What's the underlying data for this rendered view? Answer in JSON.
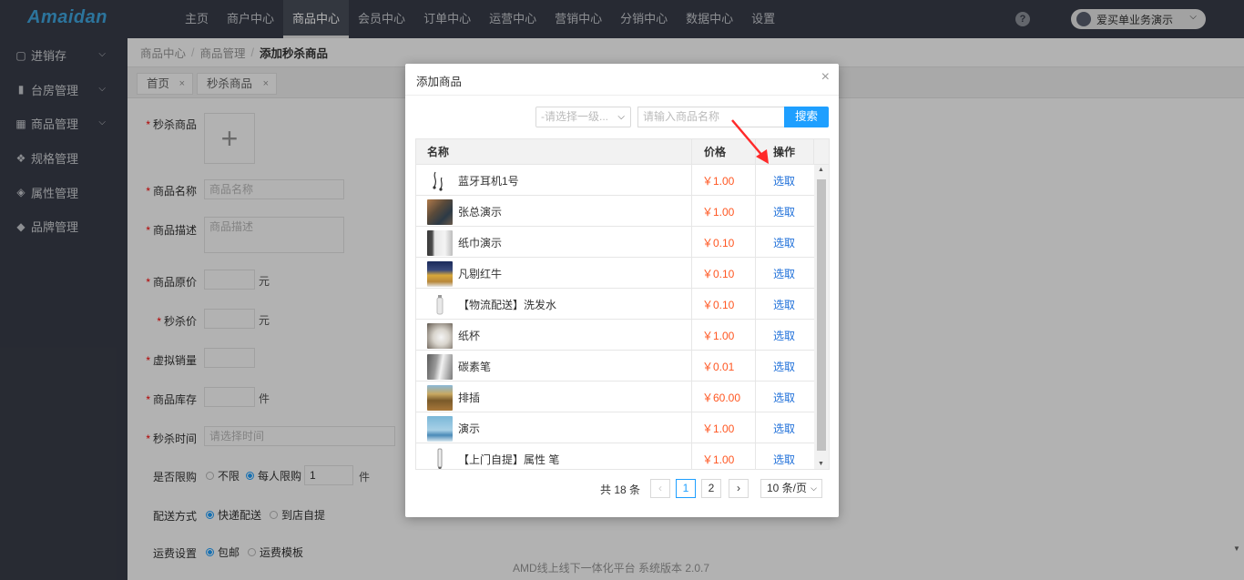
{
  "app": {
    "logo": "Amaidan",
    "help": "?",
    "user": "爱买单业务演示"
  },
  "topnav": [
    "主页",
    "商户中心",
    "商品中心",
    "会员中心",
    "订单中心",
    "运营中心",
    "营销中心",
    "分销中心",
    "数据中心",
    "设置"
  ],
  "sidebar": [
    {
      "label": "进销存",
      "icon": "map-icon",
      "glyph": "▢"
    },
    {
      "label": "台房管理",
      "icon": "bookmark-icon",
      "glyph": "▮"
    },
    {
      "label": "商品管理",
      "icon": "grid-icon",
      "glyph": "▦"
    },
    {
      "label": "规格管理",
      "icon": "cubes-icon",
      "glyph": "❖"
    },
    {
      "label": "属性管理",
      "icon": "cube-icon",
      "glyph": "◈"
    },
    {
      "label": "品牌管理",
      "icon": "tag-icon",
      "glyph": "◆"
    }
  ],
  "breadcrumb": [
    "商品中心",
    "商品管理",
    "添加秒杀商品"
  ],
  "tabs": [
    {
      "label": "首页",
      "close": "×"
    },
    {
      "label": "秒杀商品",
      "close": "×"
    }
  ],
  "form": {
    "goods": "秒杀商品",
    "name": "商品名称",
    "name_ph": "商品名称",
    "desc": "商品描述",
    "desc_ph": "商品描述",
    "orig_price": "商品原价",
    "sec_price": "秒杀价",
    "yuan": "元",
    "virtual_sales": "虚拟销量",
    "stock": "商品库存",
    "jian": "件",
    "time": "秒杀时间",
    "time_ph": "请选择时间",
    "limit": "是否限购",
    "no_limit": "不限",
    "per_limit": "每人限购",
    "limit_value": "1",
    "delivery": "配送方式",
    "express": "快递配送",
    "pickup": "到店自提",
    "freight": "运费设置",
    "free_ship": "包邮",
    "freight_tpl": "运费模板",
    "upload_plus": "+"
  },
  "footer": "AMD线上线下一体化平台 系统版本 2.0.7",
  "modal": {
    "title": "添加商品",
    "close": "×",
    "category_placeholder": "-请选择一级...",
    "search_placeholder": "请输入商品名称",
    "search_button": "搜索",
    "columns": {
      "name": "名称",
      "price": "价格",
      "op": "操作"
    },
    "rows": [
      {
        "name": "蓝牙耳机1号",
        "price": "￥1.00",
        "action": "选取",
        "thumb": "#ffffff"
      },
      {
        "name": "张总演示",
        "price": "￥1.00",
        "action": "选取",
        "thumb": "#8a6a4a"
      },
      {
        "name": "纸巾演示",
        "price": "￥0.10",
        "action": "选取",
        "thumb": "#cfcfcf"
      },
      {
        "name": "凡剔红牛",
        "price": "￥0.10",
        "action": "选取",
        "thumb": "#c79a3a"
      },
      {
        "name": "【物流配送】洗发水",
        "price": "￥0.10",
        "action": "选取",
        "thumb": "#ffffff"
      },
      {
        "name": "纸杯",
        "price": "￥1.00",
        "action": "选取",
        "thumb": "#bdb5aa"
      },
      {
        "name": "碳素笔",
        "price": "￥0.01",
        "action": "选取",
        "thumb": "#9a9a9a"
      },
      {
        "name": "排插",
        "price": "￥60.00",
        "action": "选取",
        "thumb": "#b08a4a"
      },
      {
        "name": "演示",
        "price": "￥1.00",
        "action": "选取",
        "thumb": "#7ab7d8"
      },
      {
        "name": "【上门自提】属性 笔",
        "price": "￥1.00",
        "action": "选取",
        "thumb": "#ffffff"
      }
    ],
    "pager": {
      "total": "共 18 条",
      "prev": "‹",
      "pages": [
        "1",
        "2"
      ],
      "current": "1",
      "next": "›",
      "page_size": "10 条/页"
    }
  },
  "colors": {
    "accent": "#1e9fff",
    "price": "#ff5722",
    "link": "#1e6fd9",
    "arrow": "#ff2a2a"
  }
}
